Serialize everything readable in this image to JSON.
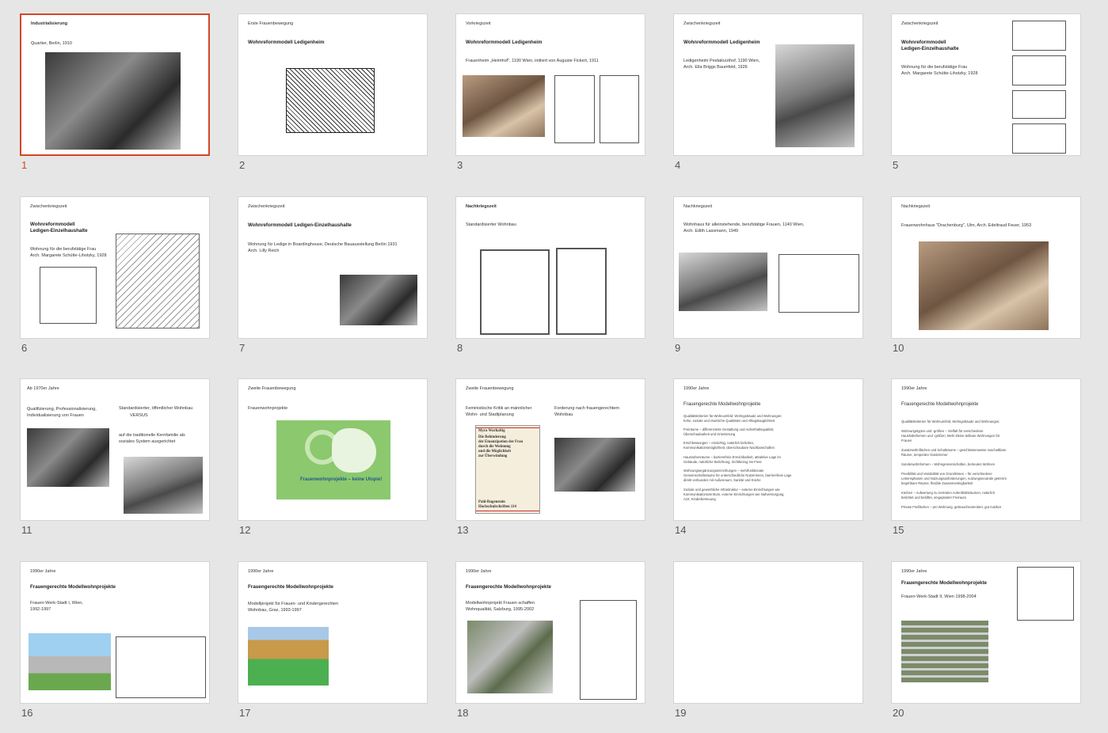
{
  "slides": [
    {
      "number": "1",
      "section": "Industrialisierung",
      "caption": "Quartier, Berlin, 1910",
      "selected": true
    },
    {
      "number": "2",
      "section": "Erste Frauenbewegung",
      "title": "Wohnreformmodell Ledigenheim"
    },
    {
      "number": "3",
      "section": "Vorkriegszeit",
      "title": "Wohnreformmodell Ledigenheim",
      "caption": "Frauenheim „Heimhof\", 1190 Wien, initiiert von Auguste Fickert, 1911"
    },
    {
      "number": "4",
      "section": "Zwischenkriegszeit",
      "title": "Wohnreformmodell Ledigenheim",
      "caption1": "Ledigenheim Pestalozzihof, 1190 Wien,",
      "caption2": "Arch. Ella Briggs Baumfeld, 1926"
    },
    {
      "number": "5",
      "section": "Zwischenkriegszeit",
      "title1": "Wohnreformmodell",
      "title2": "Ledigen-Einzelhaushalte",
      "caption1": "Wohnung für die berufstätige Frau",
      "caption2": "Arch. Margarete Schütte-Lihotzky, 1928"
    },
    {
      "number": "6",
      "section": "Zwischenkriegszeit",
      "title1": "Wohnreformmodell",
      "title2": "Ledigen-Einzelhaushalte",
      "caption1": "Wohnung für die berufstätige Frau",
      "caption2": "Arch. Margarete Schütte-Lihotzky, 1928"
    },
    {
      "number": "7",
      "section": "Zwischenkriegszeit",
      "title": "Wohnreformmodell  Ledigen-Einzelhaushalte",
      "caption1": "Wohnung für Ledige in Boardinghouse, Deutsche Bauausstellung Berlin 1931",
      "caption2": "Arch. Lilly Reich"
    },
    {
      "number": "8",
      "section": "Nachkriegszeit",
      "caption": "Standardisierter Wohnbau"
    },
    {
      "number": "9",
      "section": "Nachkriegszeit",
      "caption1": "Wohnhaus für alleinstehende, berufstätige Frauen, 1140 Wien,",
      "caption2": "Arch. Edith Lassmann, 1949"
    },
    {
      "number": "10",
      "section": "Nachkriegszeit",
      "caption": "Frauenwohnhaus \"Drachenburg\", Ulm, Arch. Edeltraud Feuer, 1953"
    },
    {
      "number": "11",
      "section": "Ab 1970er Jahre",
      "left1": "Qualifizierung, Professionalisierung,",
      "left2": "Individualisierung von Frauen",
      "versus": "VERSUS",
      "right1": "Standardisierter, öffentlicher Wohnbau",
      "right2": "auf die traditionelle Kernfamilie als",
      "right3": "soziales System ausgerichtet"
    },
    {
      "number": "12",
      "section": "Zweite Frauenbewegung",
      "caption": "Frauenwohnprojekte",
      "cover_title": "Frauenwohnprojekte – keine Utopie!"
    },
    {
      "number": "13",
      "section": "Zweite Frauenbewegung",
      "left1": "Feministische Kritik an männlicher",
      "left2": "Wohn- und Stadtplanung",
      "right1": "Forderung nach frauengerechtem",
      "right2": "Wohnbau",
      "book_author": "Myra Warhaftig",
      "book_title1": "Die Behinderung",
      "book_title2": "der Emanzipation der Frau",
      "book_title3": "durch die Wohnung",
      "book_title4": "und die Möglichkeit",
      "book_title5": "zur Überwindung",
      "book_footer1": "Pahl-Rugenstein",
      "book_footer2": "Hochschulschriften 114"
    },
    {
      "number": "14",
      "section": "1990er Jahre",
      "title": "Frauengerechte Modellwohnprojekte",
      "lines": [
        "Qualitätskriterien für Wohnumfeld, Wohngebäude und Wohnungen:",
        "hohe, soziale und räumliche Qualitäten und Alltagstauglichkeit",
        "Freiräume – differenzierte Gestaltung und Aufenthaltsqualität,",
        "Überschaubarkeit und Orientierung",
        "Erschliessungen – einsichtig, natürlich belichtet,",
        "Kommunikationsmöglichkeit, überschaubare Nachbarschaften",
        "Hausnebenräume – barrierefreie Erreichbarkeit, attraktive Lage im",
        "Gebäude, natürliche Belichtung, Sichtbezug ins Freie",
        "Wohnungsergänzungseinrichtungen – mehrfunktionale",
        "Gemeinschaftsräume für unterschiedliche Nutzerinnen, barrierefreie Lage",
        "direkt verbunden mit Außenraum, Sanitär und Küche",
        "Soziale und gewerbliche Infrastruktur – externe Einrichtungen wie",
        "Kommunikationszentrum, externe Einrichtungen wie Nahversorgung,",
        "Arzt, Kinderbetreuung"
      ]
    },
    {
      "number": "15",
      "section": "1990er Jahre",
      "title": "Frauengerechte Modellwohnprojekte",
      "lines": [
        "Qualitätskriterien für Wohnumfeld, Wohngebäude und Wohnungen:",
        "Wohnungstypen und -größen – Vielfalt für verschiedene",
        "Haushaltsformen und -größen, Mehr kleine teilbare Wohnungen für",
        "Frauen",
        "Zusatzwohnflächen und Schalträume – geschlossenweise zuschaltbare",
        "Räume, temporäre Gastzimmer",
        "Sonderwohnformen – Wohngemeinschaften, betreutes Wohnen",
        "Flexibilität und Variabilität von Grundrissen – für verschiedene",
        "Lebensphasen und Nutzungsanforderungen, nutzungsneutrale getrennt",
        "begehbare Räume, flexible Zusammenlegbarkeit",
        "Küchen – Aufwertung zu zentralen Aufenthaltsräumen, natürlich",
        "belichtet und belüftet, eingeplanter Freiraum",
        "Private Freiflächen – pro Wohnung, gebrauchsorientiert, gut nutzbar"
      ]
    },
    {
      "number": "16",
      "section": "1990er Jahre",
      "title": "Frauengerechte Modellwohnprojekte",
      "caption1": "Frauen-Werk-Stadt I, Wien,",
      "caption2": "1992-1997"
    },
    {
      "number": "17",
      "section": "1990er Jahre",
      "title": "Frauengerechte Modellwohnprojekte",
      "caption1": "Modellprojekt für Frauen- und Kindergerechten",
      "caption2": "Wohnbau, Graz, 1993-1997"
    },
    {
      "number": "18",
      "section": "1990er Jahre",
      "title": "Frauengerechte Modellwohnprojekte",
      "caption1": "Modellwohnprojekt Frauen schaffen",
      "caption2": "Wohnqualität, Salzburg, 1995-2002"
    },
    {
      "number": "19"
    },
    {
      "number": "20",
      "section": "1990er Jahre",
      "title": "Frauengerechte Modellwohnprojekte",
      "caption": "Frauen-Werk-Stadt II, Wien 1998-2004"
    }
  ],
  "colors": {
    "background": "#e6e6e6",
    "selection": "#d24726",
    "slide_bg": "#ffffff",
    "number": "#555555"
  }
}
